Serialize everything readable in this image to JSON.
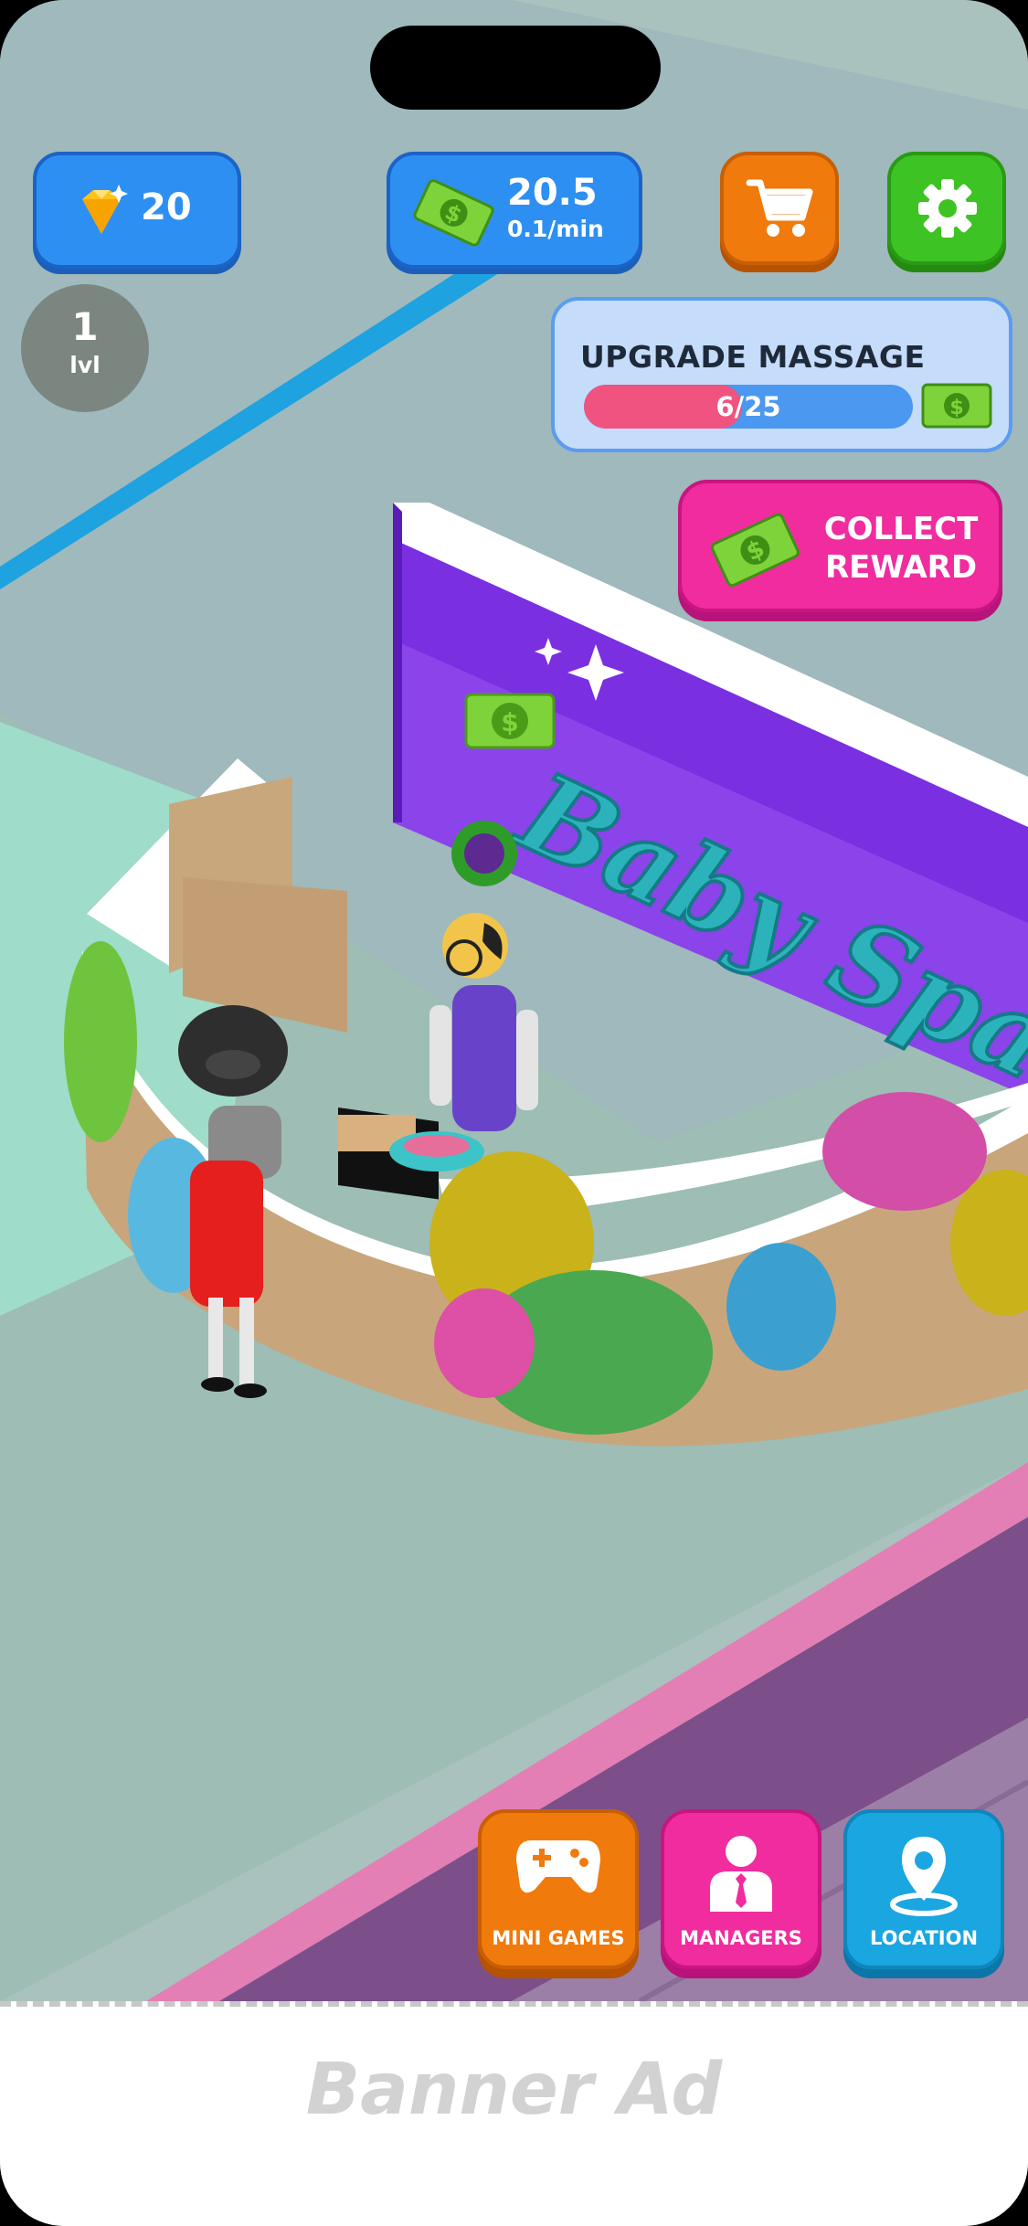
{
  "hud": {
    "gems": "20",
    "cash": "20.5",
    "cash_rate": "0.1/min",
    "level_number": "1",
    "level_label": "lvl"
  },
  "upgrade": {
    "title": "UPGRADE MASSAGE",
    "progress_text": "6/25",
    "progress_fraction": 0.24
  },
  "collect": {
    "line1": "COLLECT",
    "line2": "REWARD"
  },
  "scene": {
    "sign_text": "Baby Spa"
  },
  "bottom_nav": {
    "mini_games": "MINI GAMES",
    "managers": "MANAGERS",
    "location": "LOCATION"
  },
  "ad": {
    "label": "Banner Ad"
  },
  "colors": {
    "blue_button": "#2e8ff2",
    "orange_button": "#f07a0c",
    "green_button": "#3dc323",
    "pink_button": "#f02c9f",
    "cyan_button": "#1aa6e0",
    "progress_pink": "#f0537f"
  },
  "icons": [
    "gem-icon",
    "cash-icon",
    "cart-icon",
    "gear-icon",
    "gamepad-icon",
    "manager-icon",
    "location-pin-icon"
  ]
}
